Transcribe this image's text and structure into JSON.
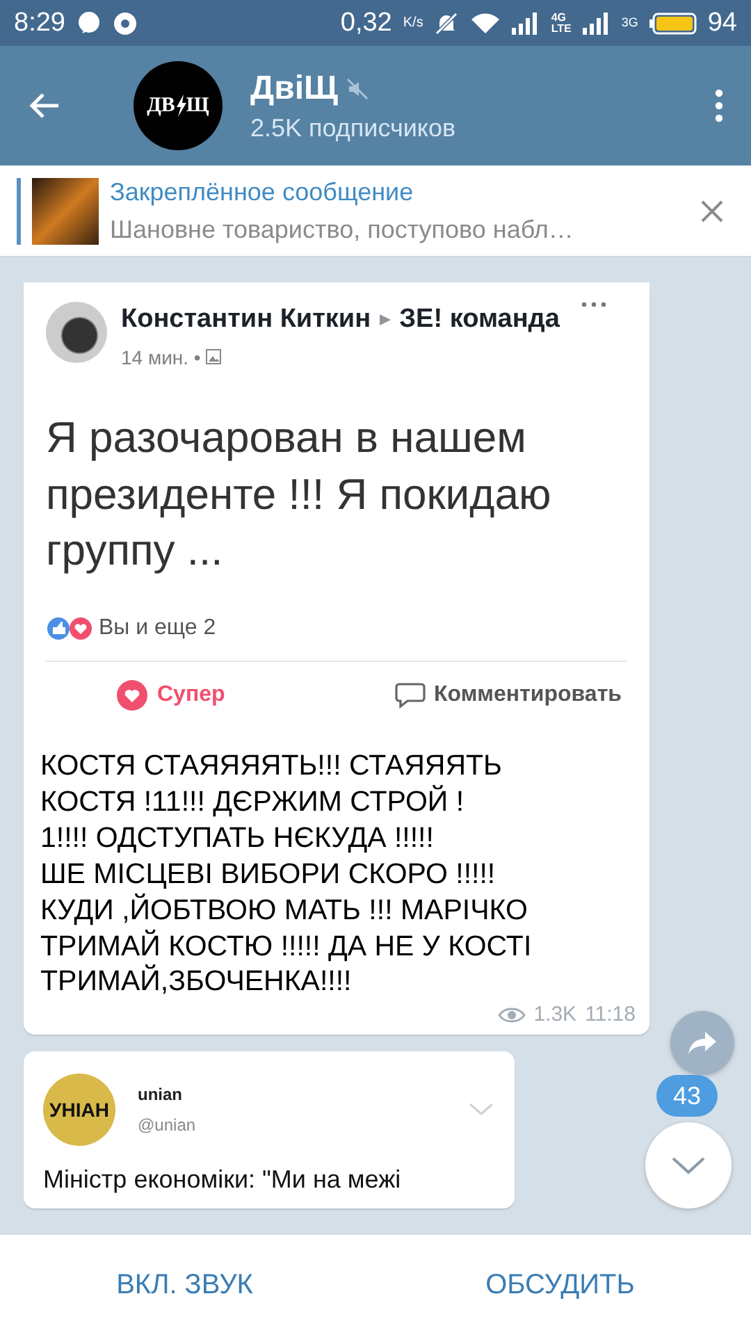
{
  "status_bar": {
    "time": "8:29",
    "speed": "0,32",
    "speed_unit": "K/s",
    "network_1": "4G",
    "network_1_sub": "LTE",
    "network_2": "3G",
    "battery": "94"
  },
  "header": {
    "avatar_left": "ДВ",
    "avatar_right": "Щ",
    "title": "ДвіЩ",
    "muted": true,
    "subtitle": "2.5K подписчиков"
  },
  "pinned": {
    "title": "Закреплённое сообщение",
    "text": "Шановне товариство, поступово набл…"
  },
  "messages": [
    {
      "kind": "post_screenshot",
      "post": {
        "author": "Константин Киткин",
        "group": "ЗЕ! команда",
        "time": "14 мин. •",
        "text": "Я разочарован в нашем президенте !!! Я покидаю группу ...",
        "reactions": "Вы и еще 2",
        "like_action": "Супер",
        "comment_action": "Комментировать"
      },
      "caption": "КОСТЯ СТАЯЯЯЯТЬ!!! СТАЯЯЯТЬ\nКОСТЯ !11!!! ДЄРЖИМ СТРОЙ !\n1!!!! ОДСТУПАТЬ НЄКУДА !!!!!\nШЕ МІСЦЕВІ ВИБОРИ СКОРО !!!!!\nКУДИ ,ЙОБТВОЮ МАТЬ !!! МАРІЧКО\nТРИМАЙ КОСТЮ !!!!! ДА НЕ У КОСТІ\nТРИМАЙ,ЗБОЧЕНКА!!!!",
      "views": "1.3K",
      "time": "11:18"
    },
    {
      "kind": "tweet_screenshot",
      "tweet": {
        "logo": "УНІАН",
        "name": "unian",
        "handle": "@unian",
        "text": "Міністр економіки: \"Ми на межі"
      }
    }
  ],
  "unread_count": "43",
  "bottom_bar": {
    "mute_button": "ВКЛ. ЗВУК",
    "discuss_button": "ОБСУДИТЬ"
  }
}
